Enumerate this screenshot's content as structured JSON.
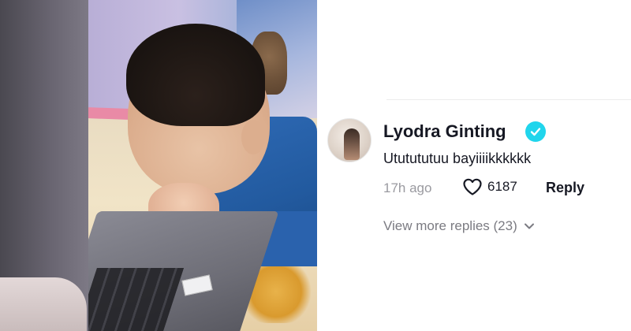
{
  "comment": {
    "username": "Lyodra Ginting",
    "verified": true,
    "text": "Ututututuu bayiiiikkkkkk",
    "timestamp": "17h ago",
    "likes": "6187",
    "reply_label": "Reply",
    "view_more_label": "View more replies (23)"
  },
  "icons": {
    "verified": "verified-check-icon",
    "like": "heart-outline-icon",
    "expand": "chevron-down-icon"
  },
  "colors": {
    "verified_badge": "#20d5ec",
    "primary_text": "#161823",
    "muted_text": "#9a9aa0"
  }
}
